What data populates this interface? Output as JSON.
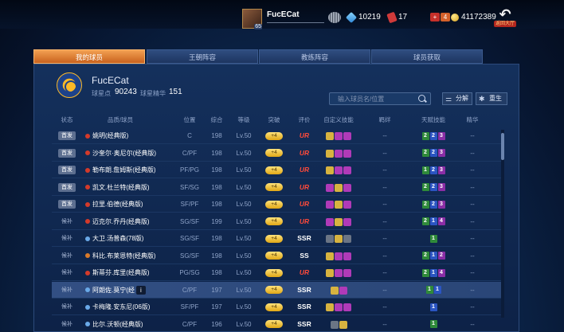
{
  "top_bar": {
    "username": "FucECat",
    "level": "65",
    "gems": "10219",
    "tickets": "17",
    "badge_red": "+",
    "badge_orange": "4",
    "coins": "41172389",
    "back_label": "返回大厅",
    "back_arrow": "↶"
  },
  "tabs": [
    "我的球员",
    "王朝阵容",
    "教练阵容",
    "球员获取"
  ],
  "team": {
    "name": "FucECat",
    "points_label": "球星点",
    "points": "90243",
    "essence_label": "球星精华",
    "essence": "151"
  },
  "search": {
    "placeholder": "输入球员名/位置"
  },
  "actions": {
    "decompose": "分解",
    "rebirth": "重生",
    "decompose_icon": "⚌",
    "rebirth_icon": "✱"
  },
  "columns": [
    "状态",
    "品质/球员",
    "位置",
    "综合",
    "等级",
    "突破",
    "评价",
    "自定义技能",
    "羁绊",
    "天赋技能",
    "精华"
  ],
  "tooltip_icon": "i",
  "rows": [
    {
      "status": "首发",
      "name": "姚明(经典版)",
      "dot": "#d43a2a",
      "pos": "C",
      "ovr": "198",
      "lvl": "Lv.50",
      "breakthrough": "+4",
      "grade": "UR",
      "talents": [
        [
          "2",
          "g"
        ],
        [
          "2",
          "b"
        ],
        [
          "3",
          "p"
        ]
      ],
      "essence": "--",
      "bond": "--",
      "highlight": false,
      "skills_colors": [
        "#d7b340",
        "#b03ab8",
        "#b03ab8"
      ]
    },
    {
      "status": "首发",
      "name": "沙奎尔·奥尼尔(经典版)",
      "dot": "#d43a2a",
      "pos": "C/PF",
      "ovr": "198",
      "lvl": "Lv.50",
      "breakthrough": "+4",
      "grade": "UR",
      "talents": [
        [
          "2",
          "g"
        ],
        [
          "2",
          "b"
        ],
        [
          "3",
          "p"
        ]
      ],
      "essence": "--",
      "bond": "--",
      "highlight": false,
      "skills_colors": [
        "#d7b340",
        "#b03ab8",
        "#b03ab8"
      ]
    },
    {
      "status": "首发",
      "name": "勒布朗.詹姆斯(经典版)",
      "dot": "#d43a2a",
      "pos": "PF/PG",
      "ovr": "198",
      "lvl": "Lv.50",
      "breakthrough": "+4",
      "grade": "UR",
      "talents": [
        [
          "1",
          "g"
        ],
        [
          "2",
          "b"
        ],
        [
          "3",
          "p"
        ]
      ],
      "essence": "--",
      "bond": "--",
      "highlight": false,
      "skills_colors": [
        "#d7b340",
        "#b03ab8",
        "#b03ab8"
      ]
    },
    {
      "status": "首发",
      "name": "凯文.杜兰特(经典版)",
      "dot": "#d43a2a",
      "pos": "SF/SG",
      "ovr": "198",
      "lvl": "Lv.50",
      "breakthrough": "+4",
      "grade": "UR",
      "talents": [
        [
          "2",
          "g"
        ],
        [
          "2",
          "b"
        ],
        [
          "3",
          "p"
        ]
      ],
      "essence": "--",
      "bond": "--",
      "highlight": false,
      "skills_colors": [
        "#b03ab8",
        "#d7b340",
        "#b03ab8"
      ]
    },
    {
      "status": "首发",
      "name": "拉里.伯德(经典版)",
      "dot": "#d43a2a",
      "pos": "SF/PF",
      "ovr": "198",
      "lvl": "Lv.50",
      "breakthrough": "+4",
      "grade": "UR",
      "talents": [
        [
          "2",
          "g"
        ],
        [
          "2",
          "b"
        ],
        [
          "3",
          "p"
        ]
      ],
      "essence": "--",
      "bond": "--",
      "highlight": false,
      "skills_colors": [
        "#b03ab8",
        "#d7b340",
        "#b03ab8"
      ]
    },
    {
      "status": "候补",
      "name": "迈克尔.乔丹(经典版)",
      "dot": "#d43a2a",
      "pos": "SG/SF",
      "ovr": "199",
      "lvl": "Lv.50",
      "breakthrough": "+4",
      "grade": "UR",
      "talents": [
        [
          "2",
          "g"
        ],
        [
          "1",
          "b"
        ],
        [
          "4",
          "p"
        ]
      ],
      "essence": "--",
      "bond": "--",
      "highlight": false,
      "skills_colors": [
        "#b03ab8",
        "#d7b340",
        "#b03ab8"
      ]
    },
    {
      "status": "候补",
      "name": "大卫.汤普森(78版)",
      "dot": "#6aa9e8",
      "pos": "SG/SF",
      "ovr": "198",
      "lvl": "Lv.50",
      "breakthrough": "+4",
      "grade": "SSR",
      "talents": [
        [
          "1",
          "g"
        ]
      ],
      "essence": "--",
      "bond": "--",
      "highlight": false,
      "skills_colors": [
        "#6b7585",
        "#d7b340",
        "#6b7585"
      ]
    },
    {
      "status": "候补",
      "name": "科比.布莱恩特(经典版)",
      "dot": "#d97a2a",
      "pos": "SG/SF",
      "ovr": "198",
      "lvl": "Lv.50",
      "breakthrough": "+4",
      "grade": "SS",
      "talents": [
        [
          "2",
          "g"
        ],
        [
          "1",
          "b"
        ],
        [
          "2",
          "p"
        ]
      ],
      "essence": "--",
      "bond": "--",
      "highlight": false,
      "skills_colors": [
        "#d7b340",
        "#b03ab8",
        "#b03ab8"
      ]
    },
    {
      "status": "候补",
      "name": "斯蒂芬.库里(经典版)",
      "dot": "#d43a2a",
      "pos": "PG/SG",
      "ovr": "198",
      "lvl": "Lv.50",
      "breakthrough": "+4",
      "grade": "UR",
      "talents": [
        [
          "2",
          "g"
        ],
        [
          "1",
          "b"
        ],
        [
          "4",
          "p"
        ]
      ],
      "essence": "--",
      "bond": "--",
      "highlight": false,
      "skills_colors": [
        "#d7b340",
        "#b03ab8",
        "#b03ab8"
      ]
    },
    {
      "status": "候补",
      "name": "阿朗佐.莫宁(经",
      "dot": "#6aa9e8",
      "pos": "C/PF",
      "ovr": "197",
      "lvl": "Lv.50",
      "breakthrough": "+4",
      "grade": "SSR",
      "talents": [
        [
          "1",
          "g"
        ],
        [
          "1",
          "b"
        ]
      ],
      "essence": "--",
      "bond": "--",
      "highlight": true,
      "skills_colors": [
        "#d7b340",
        "#b03ab8"
      ]
    },
    {
      "status": "候补",
      "name": "卡梅隆.安东尼(06版)",
      "dot": "#6aa9e8",
      "pos": "SF/PF",
      "ovr": "197",
      "lvl": "Lv.50",
      "breakthrough": "+4",
      "grade": "SSR",
      "talents": [
        [
          "1",
          "b"
        ]
      ],
      "essence": "--",
      "bond": "--",
      "highlight": false,
      "skills_colors": [
        "#d7b340",
        "#b03ab8",
        "#b03ab8"
      ]
    },
    {
      "status": "候补",
      "name": "比尔.沃顿(经典版)",
      "dot": "#6aa9e8",
      "pos": "C/PF",
      "ovr": "196",
      "lvl": "Lv.50",
      "breakthrough": "+4",
      "grade": "SSR",
      "talents": [
        [
          "1",
          "g"
        ]
      ],
      "essence": "--",
      "bond": "--",
      "highlight": false,
      "skills_colors": [
        "#6b7585",
        "#d7b340"
      ]
    }
  ]
}
